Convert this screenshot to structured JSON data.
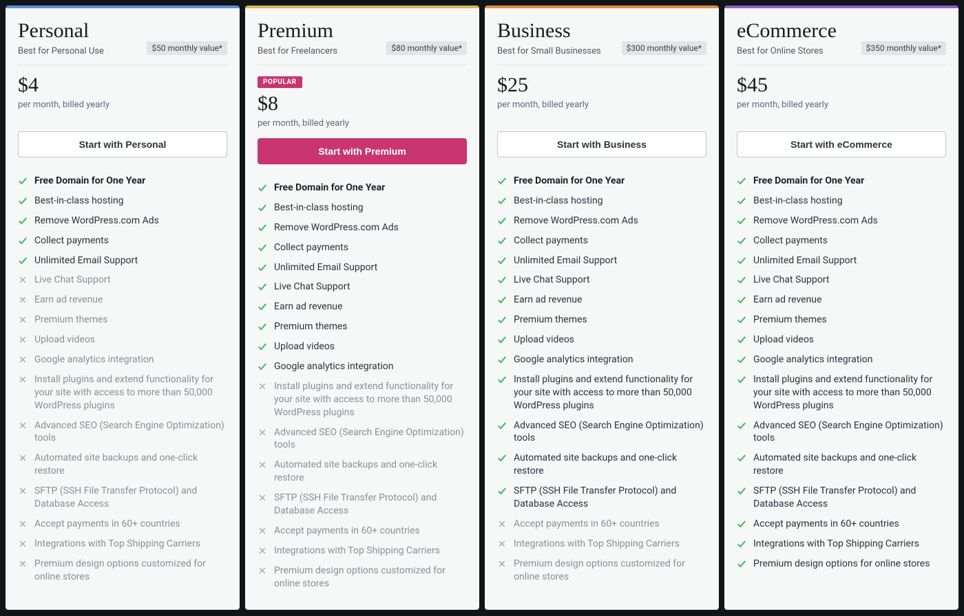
{
  "feature_labels": [
    "Free Domain for One Year",
    "Best-in-class hosting",
    "Remove WordPress.com Ads",
    "Collect payments",
    "Unlimited Email Support",
    "Live Chat Support",
    "Earn ad revenue",
    "Premium themes",
    "Upload videos",
    "Google analytics integration",
    "Install plugins and extend functionality for your site with access to more than 50,000 WordPress plugins",
    "Advanced SEO (Search Engine Optimization) tools",
    "Automated site backups and one-click restore",
    "SFTP (SSH File Transfer Protocol) and Database Access",
    "Accept payments in 60+ countries",
    "Integrations with Top Shipping Carriers",
    "Premium design options customized for online stores"
  ],
  "plans": [
    {
      "id": "personal",
      "title": "Personal",
      "subtitle": "Best for Personal Use",
      "value_badge": "$50 monthly value*",
      "popular": false,
      "price": "$4",
      "price_note": "per month, billed yearly",
      "cta": "Start with Personal",
      "cta_style": "outline",
      "accent": "#5f8dd8",
      "features": [
        true,
        true,
        true,
        true,
        true,
        false,
        false,
        false,
        false,
        false,
        false,
        false,
        false,
        false,
        false,
        false,
        false
      ]
    },
    {
      "id": "premium",
      "title": "Premium",
      "subtitle": "Best for Freelancers",
      "value_badge": "$80 monthly value*",
      "popular": true,
      "popular_label": "POPULAR",
      "price": "$8",
      "price_note": "per month, billed yearly",
      "cta": "Start with Premium",
      "cta_style": "solid",
      "accent": "#d9b94a",
      "features": [
        true,
        true,
        true,
        true,
        true,
        true,
        true,
        true,
        true,
        true,
        false,
        false,
        false,
        false,
        false,
        false,
        false
      ]
    },
    {
      "id": "business",
      "title": "Business",
      "subtitle": "Best for Small Businesses",
      "value_badge": "$300 monthly value*",
      "popular": false,
      "price": "$25",
      "price_note": "per month, billed yearly",
      "cta": "Start with Business",
      "cta_style": "outline",
      "accent": "#e28d3e",
      "features": [
        true,
        true,
        true,
        true,
        true,
        true,
        true,
        true,
        true,
        true,
        true,
        true,
        true,
        true,
        false,
        false,
        false
      ]
    },
    {
      "id": "ecommerce",
      "title": "eCommerce",
      "subtitle": "Best for Online Stores",
      "value_badge": "$350 monthly value*",
      "popular": false,
      "price": "$45",
      "price_note": "per month, billed yearly",
      "cta": "Start with eCommerce",
      "cta_style": "outline",
      "accent": "#8c5fc9",
      "features": [
        true,
        true,
        true,
        true,
        true,
        true,
        true,
        true,
        true,
        true,
        true,
        true,
        true,
        true,
        true,
        true,
        true
      ],
      "feature_label_overrides": {
        "16": "Premium design options for online stores"
      }
    }
  ]
}
